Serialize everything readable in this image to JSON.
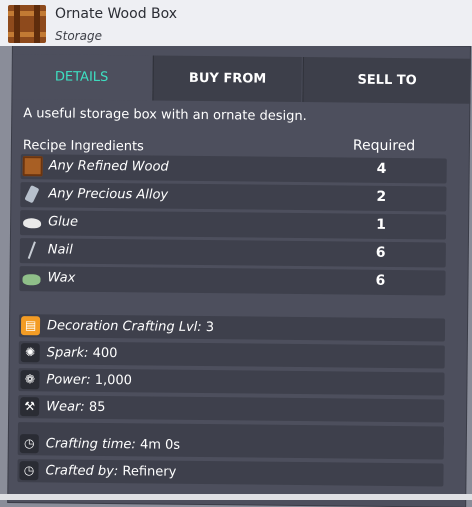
{
  "item": {
    "name": "Ornate Wood Box",
    "category": "Storage",
    "icon": "ornate-wood-box-icon"
  },
  "tabs": [
    {
      "label": "DETAILS",
      "active": true
    },
    {
      "label": "BUY FROM",
      "active": false
    },
    {
      "label": "SELL TO",
      "active": false
    }
  ],
  "description": "A useful storage box with an ornate design.",
  "ingredients": {
    "header_label": "Recipe Ingredients",
    "header_required": "Required",
    "items": [
      {
        "name": "Any Refined Wood",
        "qty": "4",
        "icon": "refined-wood-icon"
      },
      {
        "name": "Any Precious Alloy",
        "qty": "2",
        "icon": "precious-alloy-icon"
      },
      {
        "name": "Glue",
        "qty": "1",
        "icon": "glue-icon"
      },
      {
        "name": "Nail",
        "qty": "6",
        "icon": "nail-icon"
      },
      {
        "name": "Wax",
        "qty": "6",
        "icon": "wax-icon"
      }
    ]
  },
  "stats": {
    "crafting_level": {
      "label": "Decoration Crafting Lvl:",
      "value": "3"
    },
    "spark": {
      "label": "Spark:",
      "value": "400"
    },
    "power": {
      "label": "Power:",
      "value": "1,000"
    },
    "wear": {
      "label": "Wear:",
      "value": "85"
    }
  },
  "crafting": {
    "time": {
      "label": "Crafting time:",
      "value": "4m 0s"
    },
    "by": {
      "label": "Crafted by:",
      "value": "Refinery"
    }
  },
  "colors": {
    "accent": "#3ee0c2",
    "panel": "#4d4f5d",
    "row": "#3e404c",
    "book_icon": "#f39c25"
  }
}
